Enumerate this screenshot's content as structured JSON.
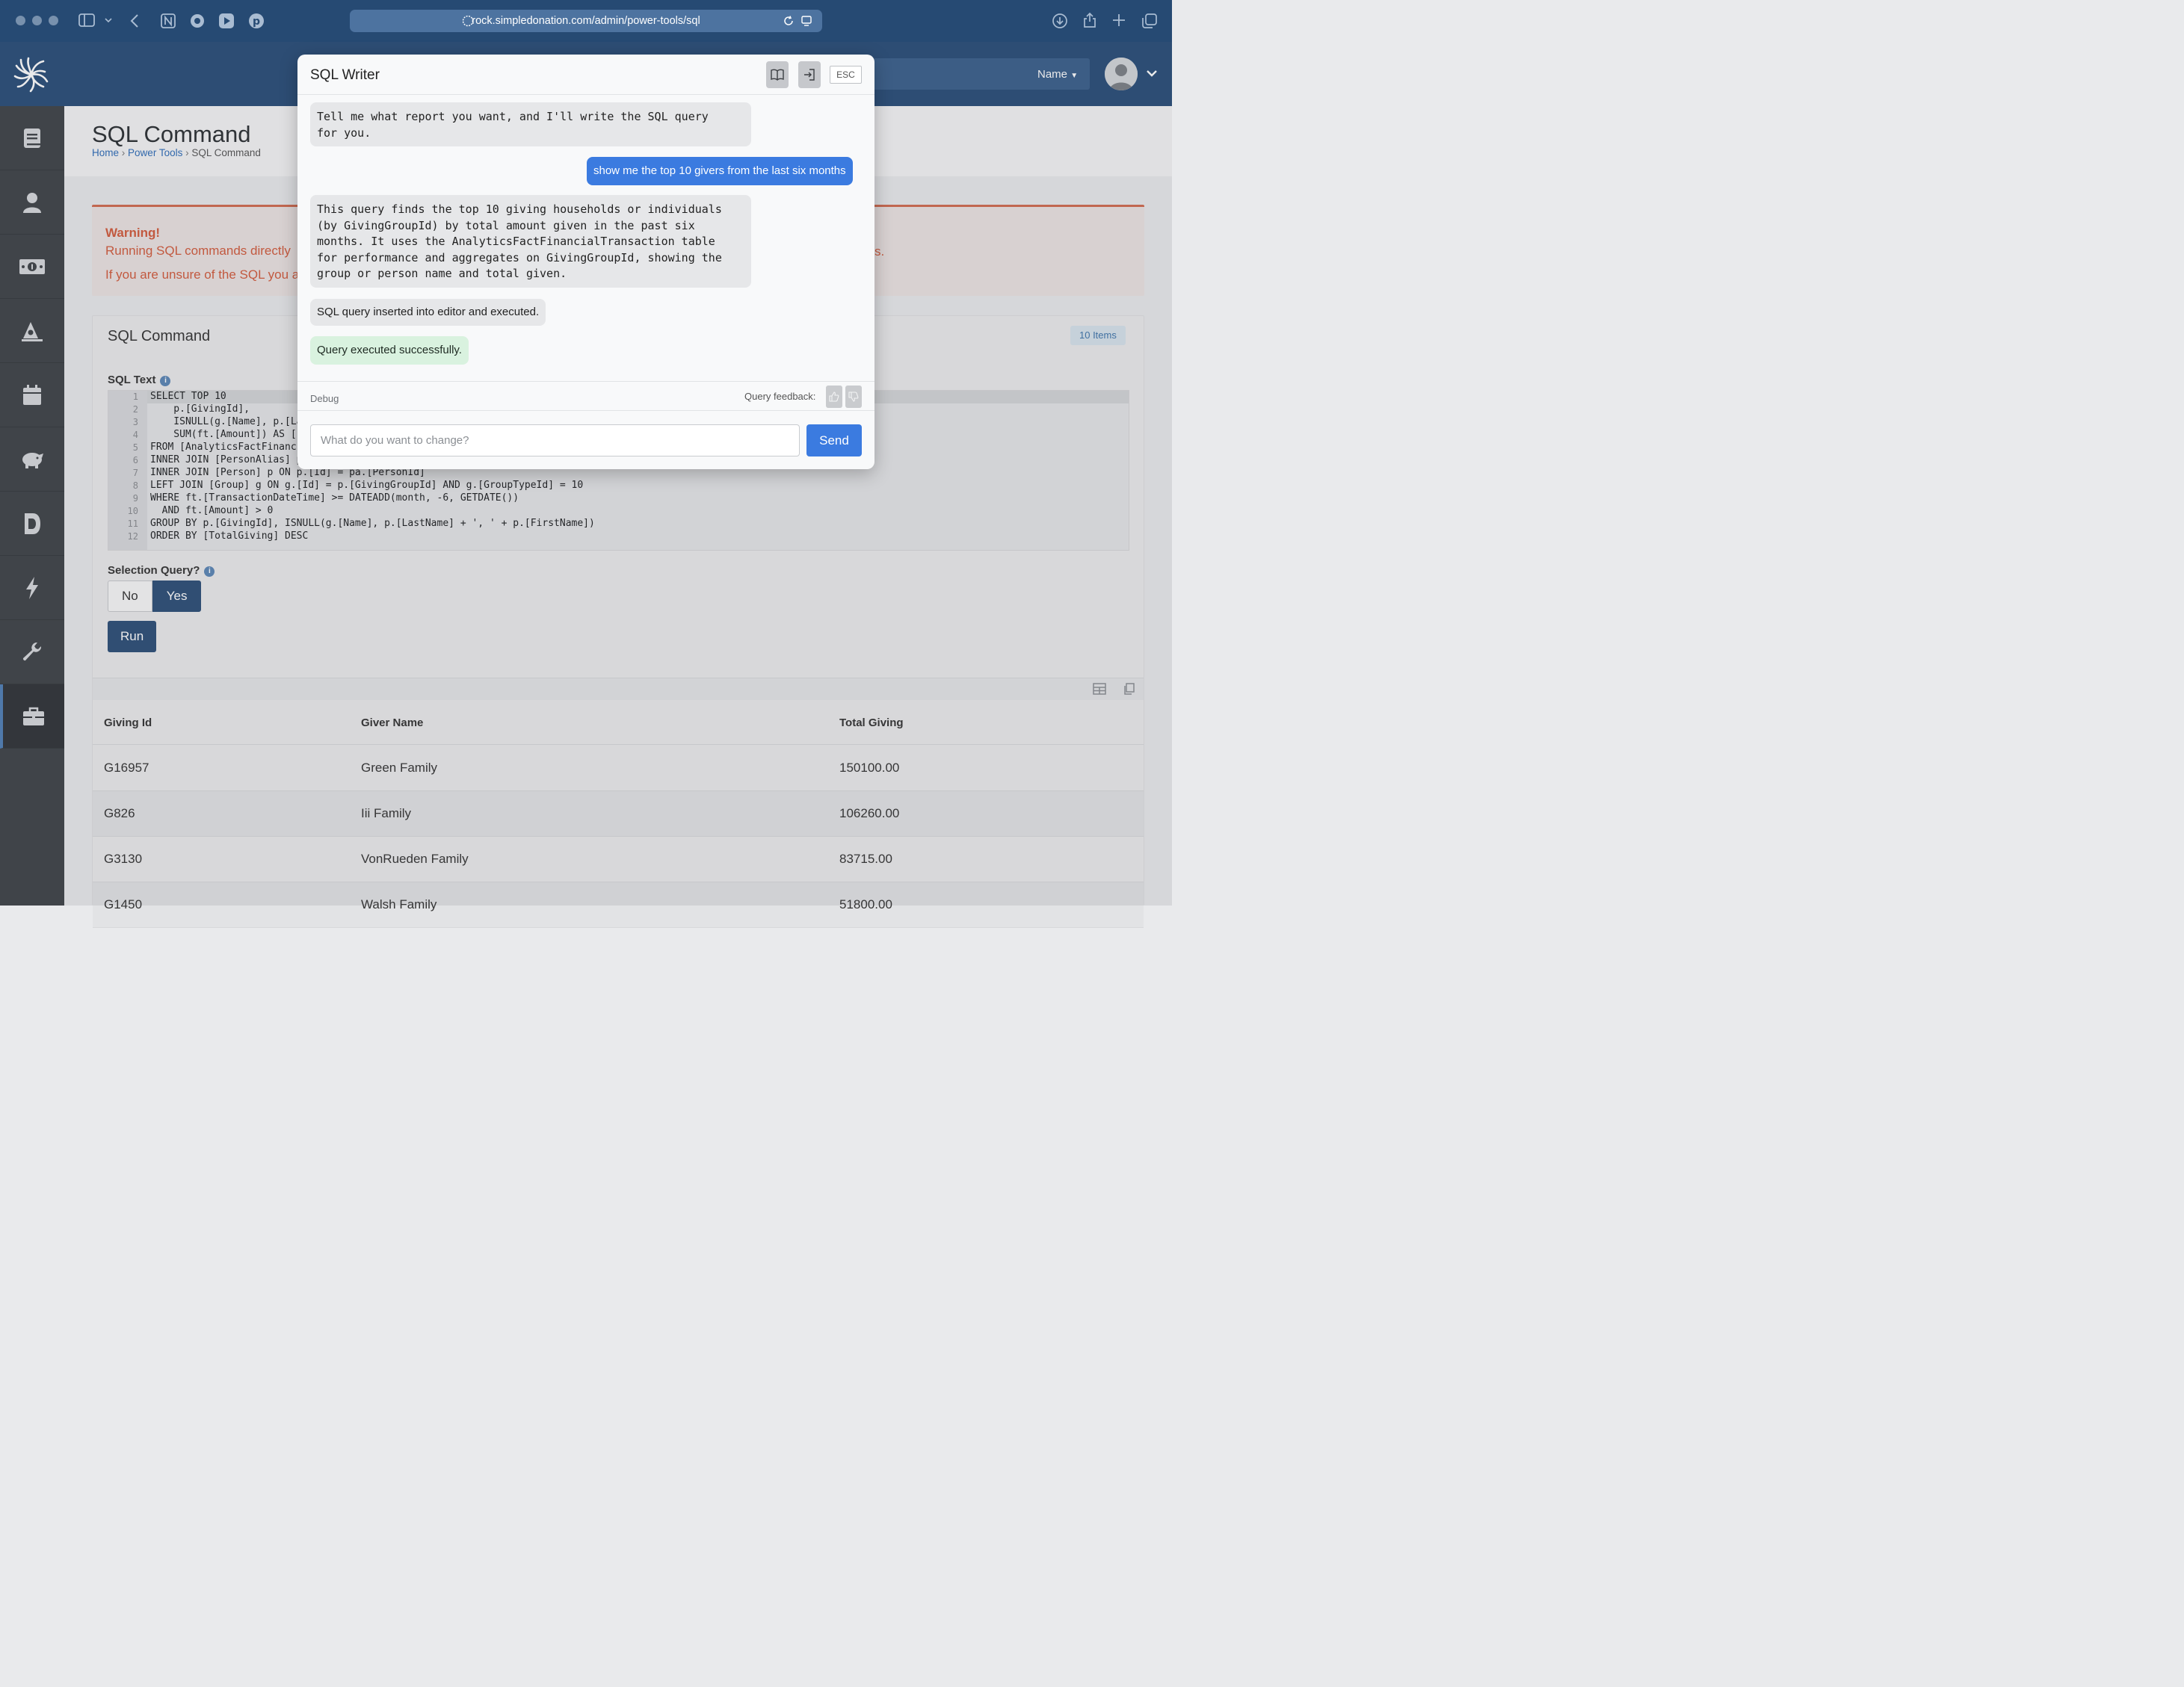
{
  "browser": {
    "url": "rock.simpledonation.com/admin/power-tools/sql"
  },
  "header": {
    "name_dropdown": "Name"
  },
  "sidebar": {
    "items": [
      {
        "icon": "book-icon"
      },
      {
        "icon": "person-icon"
      },
      {
        "icon": "money-icon"
      },
      {
        "icon": "megaphone-icon"
      },
      {
        "icon": "calendar-icon"
      },
      {
        "icon": "piggy-bank-icon"
      },
      {
        "icon": "document-icon"
      },
      {
        "icon": "lightning-icon"
      },
      {
        "icon": "wrench-icon"
      },
      {
        "icon": "briefcase-icon",
        "active": true
      }
    ]
  },
  "page": {
    "title": "SQL Command",
    "breadcrumb": [
      "Home",
      "Power Tools",
      "SQL Command"
    ]
  },
  "warning": {
    "title": "Warning!",
    "line1_start": "Running SQL commands directly",
    "line1_end": "s.",
    "line2_start": "If you are unsure of the SQL you a"
  },
  "panel": {
    "title": "SQL Command",
    "badge": "10 Items",
    "sql_text_label": "SQL Text",
    "code_lines": [
      "SELECT TOP 10",
      "    p.[GivingId],",
      "    ISNULL(g.[Name], p.[La",
      "    SUM(ft.[Amount]) AS [",
      "FROM [AnalyticsFactFinanc",
      "INNER JOIN [PersonAlias] p",
      "INNER JOIN [Person] p ON p.[Id] = pa.[PersonId]",
      "LEFT JOIN [Group] g ON g.[Id] = p.[GivingGroupId] AND g.[GroupTypeId] = 10",
      "WHERE ft.[TransactionDateTime] >= DATEADD(month, -6, GETDATE())",
      "  AND ft.[Amount] > 0",
      "GROUP BY p.[GivingId], ISNULL(g.[Name], p.[LastName] + ', ' + p.[FirstName])",
      "ORDER BY [TotalGiving] DESC"
    ],
    "line_numbers": [
      "1",
      "2",
      "3",
      "4",
      "5",
      "6",
      "7",
      "8",
      "9",
      "10",
      "11",
      "12"
    ],
    "selection_label": "Selection Query?",
    "toggle_no": "No",
    "toggle_yes": "Yes",
    "run_label": "Run"
  },
  "grid": {
    "columns": [
      "Giving Id",
      "Giver Name",
      "Total Giving"
    ],
    "rows": [
      [
        "G16957",
        "Green Family",
        "150100.00"
      ],
      [
        "G826",
        "Iii Family",
        "106260.00"
      ],
      [
        "G3130",
        "VonRueden Family",
        "83715.00"
      ],
      [
        "G1450",
        "Walsh Family",
        "51800.00"
      ]
    ]
  },
  "modal": {
    "title": "SQL Writer",
    "esc_label": "ESC",
    "messages": {
      "intro": "Tell me what report you want, and I'll write the SQL query\nfor you.",
      "user": "show me the top 10 givers from the last six months",
      "explanation": "This query finds the top 10 giving households or individuals\n(by GivingGroupId) by total amount given in the past six\nmonths. It uses the AnalyticsFactFinancialTransaction table\nfor performance and aggregates on GivingGroupId, showing the\ngroup or person name and total given.",
      "inserted": "SQL query inserted into editor and executed.",
      "success": "Query executed successfully."
    },
    "debug_label": "Debug",
    "feedback_label": "Query feedback:",
    "input_placeholder": "What do you want to change?",
    "send_label": "Send"
  }
}
